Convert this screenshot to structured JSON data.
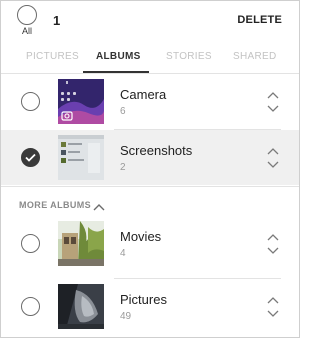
{
  "header": {
    "all_label": "All",
    "selected_count": "1",
    "delete_label": "DELETE"
  },
  "tabs": [
    {
      "label": "PICTURES",
      "active": false
    },
    {
      "label": "ALBUMS",
      "active": true
    },
    {
      "label": "STORIES",
      "active": false
    },
    {
      "label": "SHARED",
      "active": false
    }
  ],
  "albums": [
    {
      "name": "Camera",
      "count": "6",
      "selected": false
    },
    {
      "name": "Screenshots",
      "count": "2",
      "selected": true
    }
  ],
  "more_albums": {
    "label": "MORE ALBUMS",
    "icon": "chevron-up-icon",
    "items": [
      {
        "name": "Movies",
        "count": "4",
        "selected": false
      },
      {
        "name": "Pictures",
        "count": "49",
        "selected": false
      }
    ]
  },
  "colors": {
    "selected_row_bg": "#f0f0f0",
    "active_tab": "#333333",
    "inactive_tab": "#c3c3c3",
    "check_fill": "#3a3a3a"
  }
}
